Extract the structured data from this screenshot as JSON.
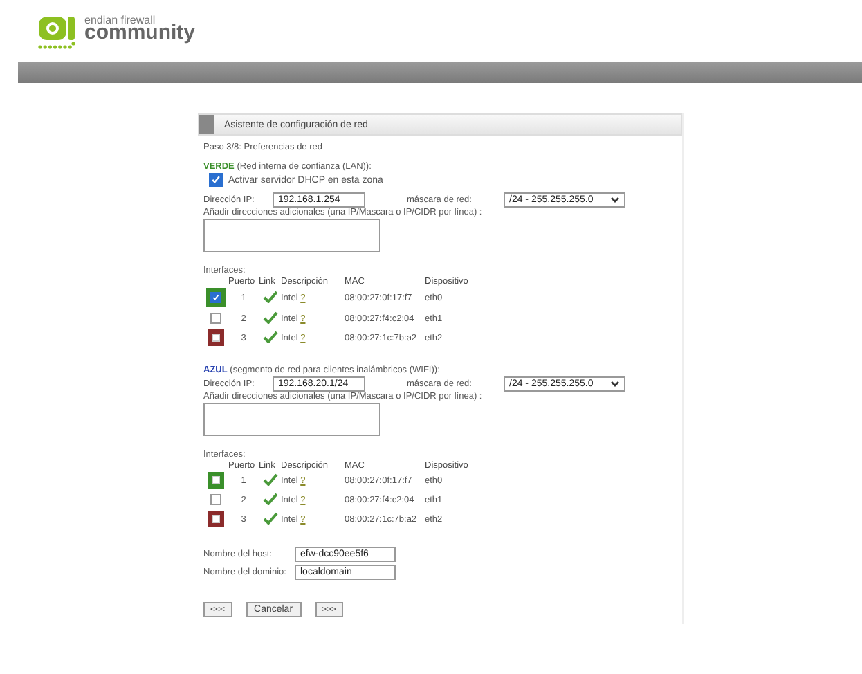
{
  "logo": {
    "line1": "endian firewall",
    "line2": "community"
  },
  "panel": {
    "title": "Asistente de configuración de red",
    "step": "Paso 3/8: Preferencias de red"
  },
  "zones": [
    {
      "name": "VERDE",
      "color": "#3a8f2a",
      "description": "(Red interna de confianza (LAN)):",
      "dhcp": {
        "label": "Activar servidor DHCP en esta zona",
        "checked": true
      },
      "ip_label": "Dirección IP:",
      "ip": "192.168.1.254",
      "mask_label": "máscara de red:",
      "mask": "/24 - 255.255.255.0",
      "extra_label": "Añadir direcciones adicionales (una IP/Mascara o IP/CIDR por línea) :",
      "interfaces_label": "Interfaces:",
      "columns": [
        "Puerto",
        "Link",
        "Descripción",
        "MAC",
        "Dispositivo"
      ],
      "interfaces": [
        {
          "kind": "checkbox",
          "port": "1",
          "desc": "Intel",
          "help": "?",
          "mac": "08:00:27:0f:17:f7",
          "device": "eth0",
          "checked": true,
          "color": "#3a8f2a"
        },
        {
          "kind": "checkbox",
          "port": "2",
          "desc": "Intel",
          "help": "?",
          "mac": "08:00:27:f4:c2:04",
          "device": "eth1",
          "checked": false
        },
        {
          "kind": "assigned",
          "port": "3",
          "desc": "Intel",
          "help": "?",
          "mac": "08:00:27:1c:7b:a2",
          "device": "eth2",
          "color": "#8b2b2b"
        }
      ]
    },
    {
      "name": "AZUL",
      "color": "#2a44b0",
      "description": "(segmento de red para clientes inalámbricos (WIFI)):",
      "ip_label": "Dirección IP:",
      "ip": "192.168.20.1/24",
      "mask_label": "máscara de red:",
      "mask": "/24 - 255.255.255.0",
      "extra_label": "Añadir direcciones adicionales (una IP/Mascara o IP/CIDR por línea) :",
      "interfaces_label": "Interfaces:",
      "columns": [
        "Puerto",
        "Link",
        "Descripción",
        "MAC",
        "Dispositivo"
      ],
      "interfaces": [
        {
          "kind": "assigned",
          "port": "1",
          "desc": "Intel",
          "help": "?",
          "mac": "08:00:27:0f:17:f7",
          "device": "eth0",
          "color": "#3a8f2a"
        },
        {
          "kind": "checkbox",
          "port": "2",
          "desc": "Intel",
          "help": "?",
          "mac": "08:00:27:f4:c2:04",
          "device": "eth1",
          "checked": false
        },
        {
          "kind": "assigned",
          "port": "3",
          "desc": "Intel",
          "help": "?",
          "mac": "08:00:27:1c:7b:a2",
          "device": "eth2",
          "color": "#8b2b2b"
        }
      ]
    }
  ],
  "host": {
    "host_label": "Nombre del host:",
    "host": "efw-dcc90ee5f6",
    "domain_label": "Nombre del dominio:",
    "domain": "localdomain"
  },
  "buttons": [
    "<<<",
    "Cancelar",
    ">>>"
  ]
}
